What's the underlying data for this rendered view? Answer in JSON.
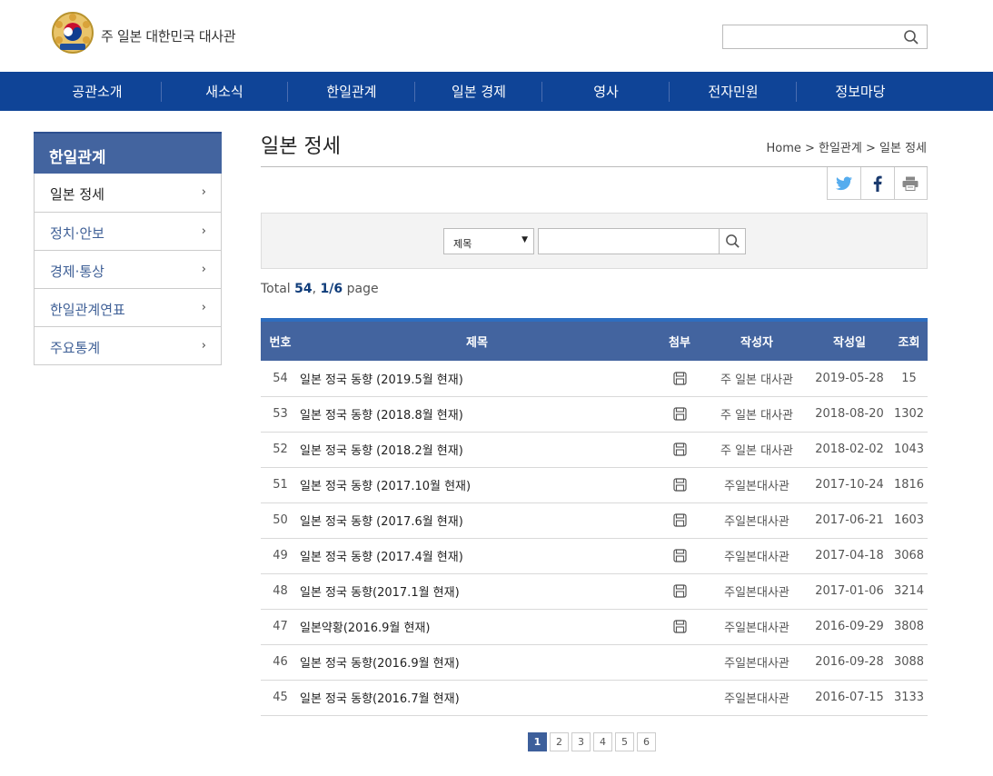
{
  "header": {
    "site_title": "주 일본 대한민국 대사관",
    "search_placeholder": ""
  },
  "nav": {
    "items": [
      "공관소개",
      "새소식",
      "한일관계",
      "일본 경제",
      "영사",
      "전자민원",
      "정보마당"
    ]
  },
  "sidebar": {
    "title": "한일관계",
    "items": [
      {
        "label": "일본 정세",
        "active": true
      },
      {
        "label": "정치·안보",
        "active": false
      },
      {
        "label": "경제·통상",
        "active": false
      },
      {
        "label": "한일관계연표",
        "active": false
      },
      {
        "label": "주요통계",
        "active": false
      }
    ]
  },
  "main": {
    "title": "일본 정세",
    "breadcrumb": "Home > 한일관계 > 일본 정세",
    "search": {
      "field_selected": "제목",
      "keyword": ""
    },
    "total": {
      "prefix": "Total ",
      "count": "54",
      "sep": ", ",
      "page": "1/6",
      "suffix": " page"
    },
    "table": {
      "headers": [
        "번호",
        "제목",
        "첨부",
        "작성자",
        "작성일",
        "조회"
      ],
      "rows": [
        {
          "no": "54",
          "title": "일본 정국 동향 (2019.5월 현재)",
          "attach": true,
          "author": "주 일본 대사관",
          "date": "2019-05-28",
          "views": "15"
        },
        {
          "no": "53",
          "title": "일본 정국 동향 (2018.8월 현재)",
          "attach": true,
          "author": "주 일본 대사관",
          "date": "2018-08-20",
          "views": "1302"
        },
        {
          "no": "52",
          "title": "일본 정국 동향 (2018.2월 현재)",
          "attach": true,
          "author": "주 일본 대사관",
          "date": "2018-02-02",
          "views": "1043"
        },
        {
          "no": "51",
          "title": "일본 정국 동향 (2017.10월 현재)",
          "attach": true,
          "author": "주일본대사관",
          "date": "2017-10-24",
          "views": "1816"
        },
        {
          "no": "50",
          "title": "일본 정국 동향 (2017.6월 현재)",
          "attach": true,
          "author": "주일본대사관",
          "date": "2017-06-21",
          "views": "1603"
        },
        {
          "no": "49",
          "title": "일본 정국 동향 (2017.4월 현재)",
          "attach": true,
          "author": "주일본대사관",
          "date": "2017-04-18",
          "views": "3068"
        },
        {
          "no": "48",
          "title": "일본 정국 동향(2017.1월 현재)",
          "attach": true,
          "author": "주일본대사관",
          "date": "2017-01-06",
          "views": "3214"
        },
        {
          "no": "47",
          "title": "일본약황(2016.9월 현재)",
          "attach": true,
          "author": "주일본대사관",
          "date": "2016-09-29",
          "views": "3808"
        },
        {
          "no": "46",
          "title": "일본 정국 동향(2016.9월 현재)",
          "attach": false,
          "author": "주일본대사관",
          "date": "2016-09-28",
          "views": "3088"
        },
        {
          "no": "45",
          "title": "일본 정국 동향(2016.7월 현재)",
          "attach": false,
          "author": "주일본대사관",
          "date": "2016-07-15",
          "views": "3133"
        }
      ]
    },
    "pagination": {
      "pages": [
        "1",
        "2",
        "3",
        "4",
        "5",
        "6"
      ],
      "current": "1"
    }
  },
  "icons": {
    "search": "search-icon",
    "twitter": "twitter-icon",
    "facebook": "facebook-icon",
    "print": "print-icon",
    "attachment": "floppy-disk-icon",
    "chevron": "chevron-right-icon",
    "logo": "embassy-emblem-icon"
  },
  "colors": {
    "nav_bg": "#0f4497",
    "sidebar_title_bg": "#43649f",
    "table_header_bg": "#43649f",
    "table_header_top": "#2e6ec0",
    "pager_current": "#3d5f9b",
    "twitter": "#55acee",
    "facebook": "#1a3a6e"
  }
}
